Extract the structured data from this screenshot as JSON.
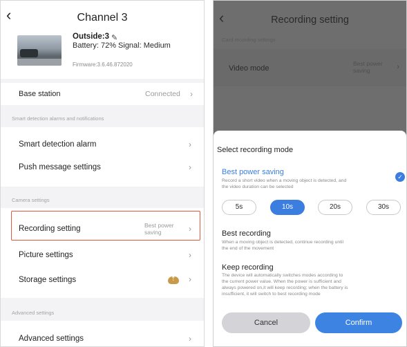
{
  "left": {
    "title": "Channel 3",
    "device": {
      "name": "Outside:3",
      "status": "Battery: 72% Signal: Medium",
      "firmware": "Firmware:3.6.46.872020"
    },
    "base_station": {
      "label": "Base station",
      "value": "Connected"
    },
    "section_alarms": "Smart detection alarms and notifications",
    "smart_detection": "Smart detection alarm",
    "push_message": "Push message settings",
    "section_camera": "Camera settings",
    "recording": {
      "label": "Recording setting",
      "value_line1": "Best power",
      "value_line2": "saving"
    },
    "picture": "Picture settings",
    "storage": "Storage settings",
    "section_advanced": "Advanced settings",
    "advanced": "Advanced settings"
  },
  "right": {
    "title": "Recording setting",
    "section": "Card recording settings",
    "video_mode": {
      "label": "Video mode",
      "value_line1": "Best power",
      "value_line2": "saving"
    },
    "sheet": {
      "title": "Select recording mode",
      "options": [
        {
          "title": "Best power saving",
          "desc_line1": "Record a short video when a moving object is detected, and",
          "desc_line2": "the video duration can be selected",
          "desc_line3": ""
        },
        {
          "title": "Best recording",
          "desc_line1": "When a moving object is detected, continue recording until",
          "desc_line2": "the end of the movement",
          "desc_line3": ""
        },
        {
          "title": "Keep recording",
          "desc_line1": "The device will automatically switches modes according to",
          "desc_line2": "the current power value. When the power is sufficient and",
          "desc_line3": "always powered on,it will keep recording; when the battery is",
          "desc_line4": "insufficient, it will switch to best recording mode"
        }
      ],
      "durations": [
        "5s",
        "10s",
        "20s",
        "30s"
      ],
      "selected_duration": "10s",
      "cancel": "Cancel",
      "confirm": "Confirm"
    }
  },
  "colors": {
    "accent": "#3b7ee0",
    "highlight": "#e0593f",
    "overlay": "#6e6e6e"
  }
}
